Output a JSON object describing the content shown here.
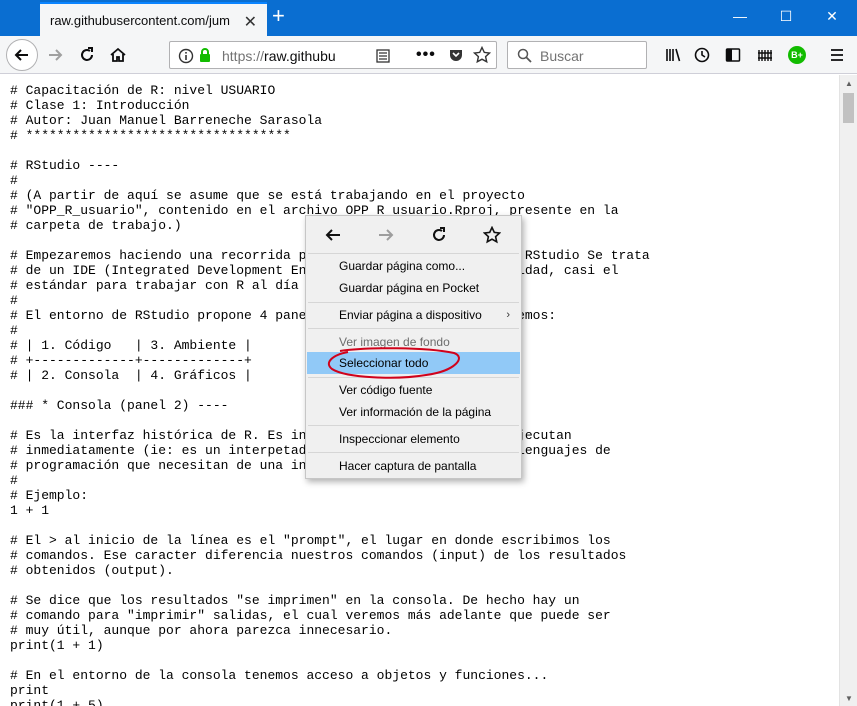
{
  "browser": {
    "tab_title": "raw.githubusercontent.com/jumanbar",
    "url_scheme": "https://",
    "url_host": "raw.githubu",
    "search_placeholder": "Buscar",
    "addon_badge": "B+"
  },
  "page": {
    "text": "# Capacitación de R: nivel USUARIO\n# Clase 1: Introducción\n# Autor: Juan Manuel Barreneche Sarasola\n# **********************************\n\n# RStudio ----\n#\n# (A partir de aquí se asume que se está trabajando en el proyecto\n# \"OPP_R_usuario\", contenido en el archivo OPP_R_usuario.Rproj, presente en la\n# carpeta de trabajo.)\n\n# Empezaremos haciendo una recorrida por el entorno de trabajo de RStudio Se trata\n# de un IDE (Integrated Development Environment) que en la actualidad, casi el\n# estándar para trabajar con R al día de hoy.\n#\n# El entorno de RStudio propone 4 paneles principales, que llamaremos:\n#\n# | 1. Código   | 3. Ambiente |\n# +-------------+-------------+\n# | 2. Consola  | 4. Gráficos |\n\n### * Consola (panel 2) ----\n\n# Es la interfaz histórica de R. Es interactiva: las órdenes se ejecutan\n# inmediatamente (ie: es un interpetador), a diferencia de otros lenguajes de\n# programación que necesitan de una instancia de compilación.\n#\n# Ejemplo:\n1 + 1\n\n# El > al inicio de la línea es el \"prompt\", el lugar en donde escribimos los\n# comandos. Ese caracter diferencia nuestros comandos (input) de los resultados\n# obtenidos (output).\n\n# Se dice que los resultados \"se imprimen\" en la consola. De hecho hay un\n# comando para \"imprimir\" salidas, el cual veremos más adelante que puede ser\n# muy útil, aunque por ahora parezca innecesario.\nprint(1 + 1)\n\n# En el entorno de la consola tenemos acceso a objetos y funciones...\nprint\nprint(1 + 5)"
  },
  "context_menu": {
    "items": [
      {
        "label": "Guardar página como...",
        "enabled": true
      },
      {
        "label": "Guardar página en Pocket",
        "enabled": true
      },
      {
        "label": "Enviar página a dispositivo",
        "enabled": true,
        "submenu": true
      },
      {
        "label": "Ver imagen de fondo",
        "enabled": false
      },
      {
        "label": "Seleccionar todo",
        "enabled": true,
        "highlighted": true
      },
      {
        "label": "Ver código fuente",
        "enabled": true
      },
      {
        "label": "Ver información de la página",
        "enabled": true
      },
      {
        "label": "Inspeccionar elemento",
        "enabled": true
      },
      {
        "label": "Hacer captura de pantalla",
        "enabled": true
      }
    ]
  },
  "colors": {
    "titlebar": "#0a6ed1",
    "highlight": "#91c9f7",
    "annotation": "#d0021b",
    "secure": "#12bc00"
  },
  "icons": {
    "back": "back-arrow-icon",
    "forward": "forward-arrow-icon",
    "reload": "reload-icon",
    "home": "home-icon",
    "info": "info-icon",
    "lock": "lock-icon",
    "reader": "reader-view-icon",
    "more": "page-actions-icon",
    "pocket": "pocket-icon",
    "bookmark": "star-icon",
    "search": "search-icon",
    "library": "library-icon",
    "history": "history-icon",
    "sidebar": "sidebar-icon",
    "extension": "extension-icon",
    "menu": "hamburger-menu-icon"
  }
}
